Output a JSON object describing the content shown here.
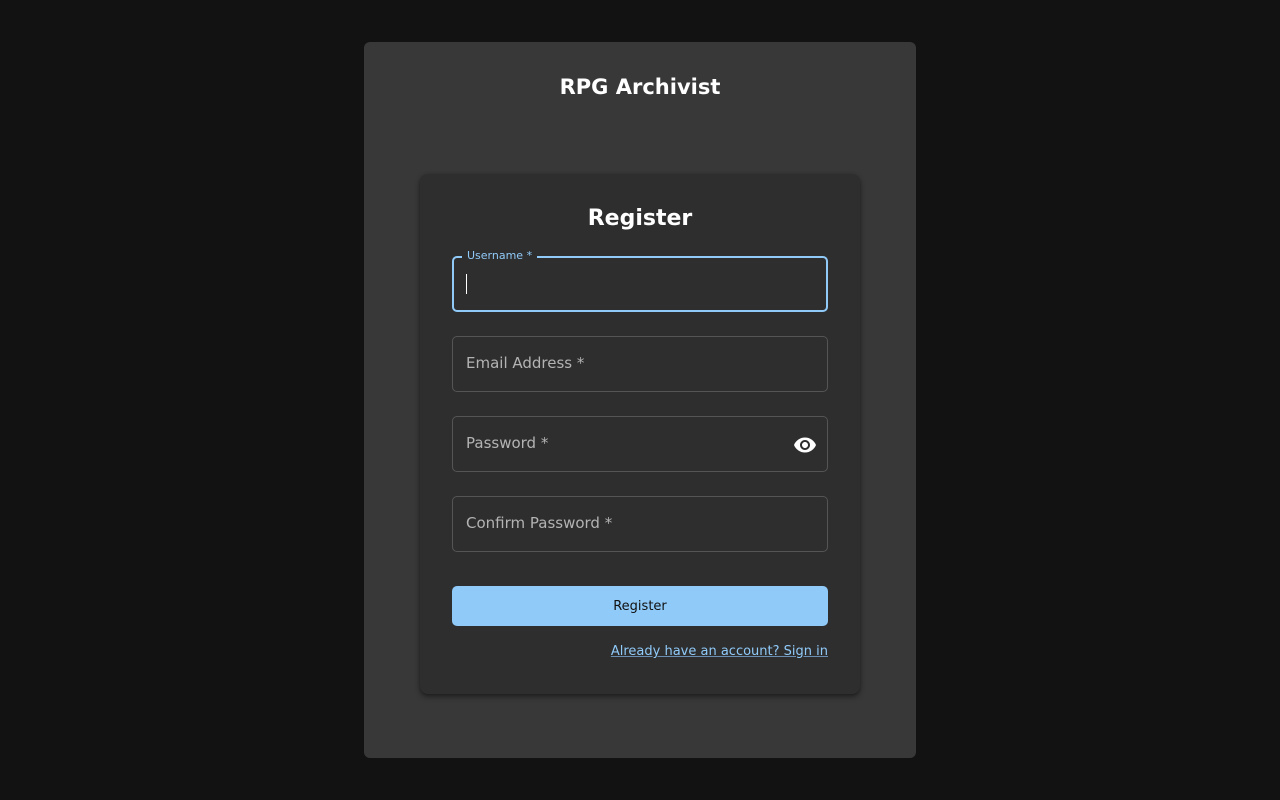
{
  "app": {
    "title": "RPG Archivist"
  },
  "register_form": {
    "heading": "Register",
    "fields": {
      "username": {
        "label": "Username *",
        "value": "",
        "focused": true
      },
      "email": {
        "placeholder": "Email Address *",
        "value": ""
      },
      "password": {
        "placeholder": "Password *",
        "value": "",
        "toggle_icon": "eye-icon"
      },
      "confirm_password": {
        "placeholder": "Confirm Password *",
        "value": ""
      }
    },
    "submit_label": "Register",
    "signin_link": "Already have an account? Sign in"
  },
  "colors": {
    "background": "#121212",
    "panel": "#383838",
    "card": "#2e2e2e",
    "accent": "#90caf9"
  }
}
